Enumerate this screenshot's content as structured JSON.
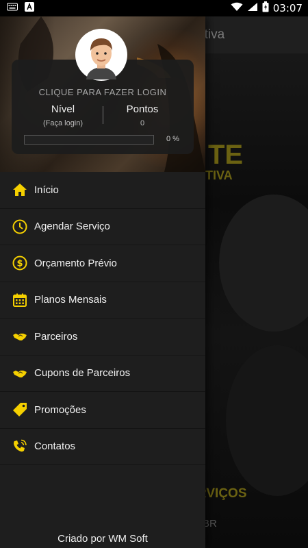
{
  "status_bar": {
    "time": "03:07",
    "icons": [
      "keyboard-icon",
      "notification-a-icon",
      "wifi-icon",
      "signal-icon",
      "battery-icon"
    ]
  },
  "background_app": {
    "title": "otiva",
    "hero_line1": "TE",
    "hero_line2": "TIVA",
    "section_label": "RVIÇOS",
    "sub_label": "BR"
  },
  "drawer": {
    "login_prompt": "CLIQUE PARA FAZER LOGIN",
    "level": {
      "label": "Nível",
      "value": "(Faça login)"
    },
    "points": {
      "label": "Pontos",
      "value": "0"
    },
    "progress": {
      "fraction": 0.0,
      "label": "0 %"
    },
    "menu": [
      {
        "label": "Início",
        "icon": "home-icon"
      },
      {
        "label": "Agendar Serviço",
        "icon": "clock-icon"
      },
      {
        "label": "Orçamento Prévio",
        "icon": "dollar-circle-icon"
      },
      {
        "label": "Planos Mensais",
        "icon": "calendar-icon"
      },
      {
        "label": "Parceiros",
        "icon": "handshake-icon"
      },
      {
        "label": "Cupons de Parceiros",
        "icon": "handshake-icon"
      },
      {
        "label": "Promoções",
        "icon": "tag-icon"
      },
      {
        "label": "Contatos",
        "icon": "phone-call-icon"
      }
    ],
    "footer": "Criado por WM Soft"
  },
  "colors": {
    "accent": "#f5d000",
    "drawer_bg": "#1e1e1e",
    "card_bg": "#1c1c1c"
  }
}
